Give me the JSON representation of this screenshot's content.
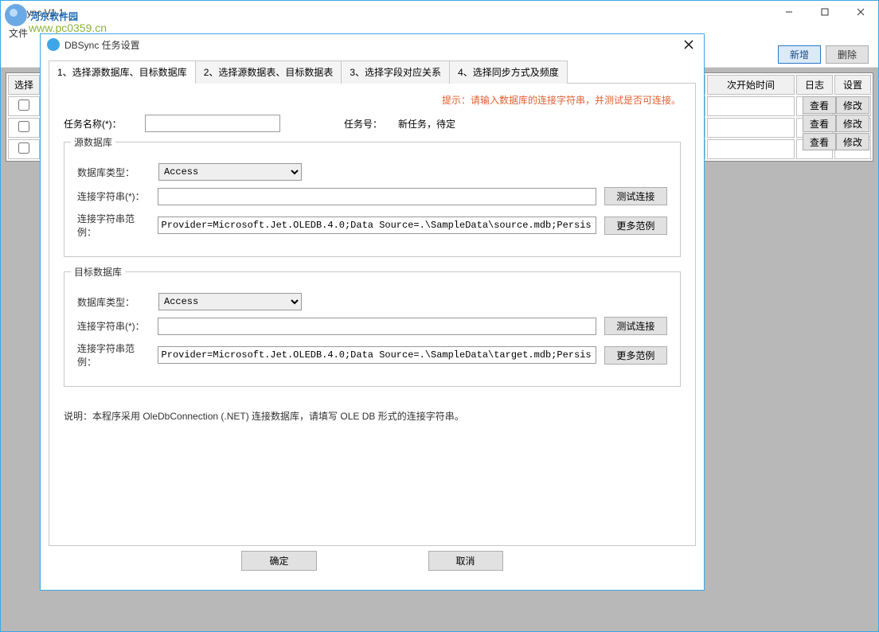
{
  "watermark": {
    "title": "河东软件园",
    "url": "www.pc0359.cn"
  },
  "main": {
    "title": "DBSync V1.1",
    "menu_file": "文件",
    "toolbar": {
      "add": "新增",
      "delete": "删除"
    },
    "grid": {
      "col_select": "选择",
      "col_nextstart": "次开始时间",
      "col_log": "日志",
      "col_settings": "设置",
      "btn_view": "查看",
      "btn_modify": "修改"
    }
  },
  "modal": {
    "title": "DBSync 任务设置",
    "tabs": {
      "t1": "1、选择源数据库、目标数据库",
      "t2": "2、选择源数据表、目标数据表",
      "t3": "3、选择字段对应关系",
      "t4": "4、选择同步方式及频度"
    },
    "hint": "提示：请输入数据库的连接字符串，并测试是否可连接。",
    "taskname_label": "任务名称(*)：",
    "taskno_label": "任务号：",
    "taskno_value": "新任务，待定",
    "source": {
      "group_title": "源数据库",
      "dbtype_label": "数据库类型：",
      "dbtype_value": "Access",
      "conn_label": "连接字符串(*)：",
      "sample_label": "连接字符串范例：",
      "sample_value": "Provider=Microsoft.Jet.OLEDB.4.0;Data Source=.\\SampleData\\source.mdb;Persist Security Info=Fa",
      "btn_test": "测试连接",
      "btn_more": "更多范例"
    },
    "target": {
      "group_title": "目标数据库",
      "dbtype_label": "数据库类型：",
      "dbtype_value": "Access",
      "conn_label": "连接字符串(*)：",
      "sample_label": "连接字符串范例：",
      "sample_value": "Provider=Microsoft.Jet.OLEDB.4.0;Data Source=.\\SampleData\\target.mdb;Persist Security Info=Fa",
      "btn_test": "测试连接",
      "btn_more": "更多范例"
    },
    "note": "说明：本程序采用 OleDbConnection (.NET) 连接数据库，请填写 OLE DB 形式的连接字符串。",
    "btn_ok": "确定",
    "btn_cancel": "取消"
  }
}
